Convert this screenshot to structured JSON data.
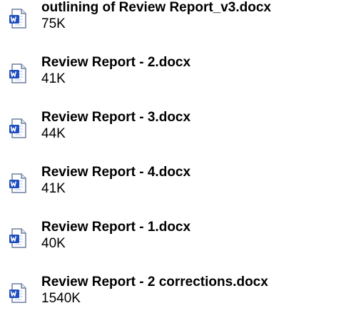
{
  "files": [
    {
      "name": "outlining of Review Report_v3.docx",
      "size": "75K",
      "icon": "word-document-icon"
    },
    {
      "name": "Review Report - 2.docx",
      "size": "41K",
      "icon": "word-document-icon"
    },
    {
      "name": "Review Report - 3.docx",
      "size": "44K",
      "icon": "word-document-icon"
    },
    {
      "name": "Review Report - 4.docx",
      "size": "41K",
      "icon": "word-document-icon"
    },
    {
      "name": "Review Report - 1.docx",
      "size": "40K",
      "icon": "word-document-icon"
    },
    {
      "name": "Review Report - 2 corrections.docx",
      "size": "1540K",
      "icon": "word-document-icon"
    }
  ],
  "colors": {
    "text": "#000000",
    "icon_blue": "#1f4fbf",
    "icon_page": "#ffffff",
    "icon_border": "#6f7f9f"
  }
}
